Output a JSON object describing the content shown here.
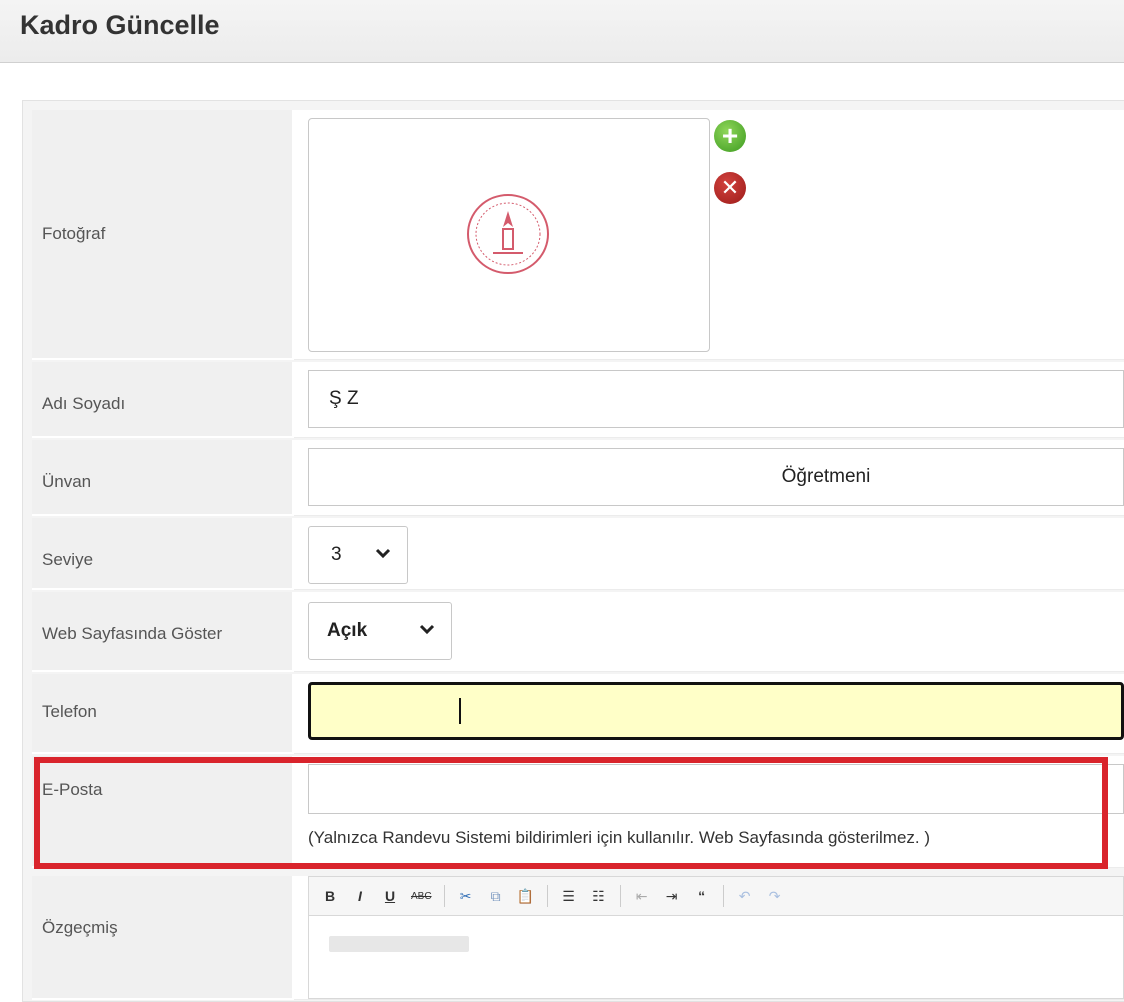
{
  "header": {
    "title": "Kadro Güncelle"
  },
  "form": {
    "photo": {
      "label": "Fotoğraf",
      "add_icon": "plus-circle",
      "remove_icon": "x-circle",
      "image": "seal-logo"
    },
    "name": {
      "label": "Adı Soyadı",
      "value": "Ş                  Z"
    },
    "title": {
      "label": "Ünvan",
      "value": "Öğretmeni"
    },
    "level": {
      "label": "Seviye",
      "value": "3"
    },
    "web_show": {
      "label": "Web Sayfasında Göster",
      "value": "Açık"
    },
    "phone": {
      "label": "Telefon",
      "value": ""
    },
    "email": {
      "label": "E-Posta",
      "value": "",
      "hint": "(Yalnızca Randevu Sistemi bildirimleri için kullanılır. Web Sayfasında gösterilmez. )"
    },
    "cv": {
      "label": "Özgeçmiş",
      "toolbar": [
        "B",
        "I",
        "U",
        "ABC",
        "cut",
        "copy",
        "paste",
        "bullet-list",
        "numbered-list",
        "outdent",
        "indent",
        "quote",
        "undo",
        "redo"
      ]
    }
  },
  "colors": {
    "highlight": "#d9242c",
    "focus_fill": "#ffffc8",
    "add": "#3c9a1f",
    "remove": "#9c1b19"
  }
}
